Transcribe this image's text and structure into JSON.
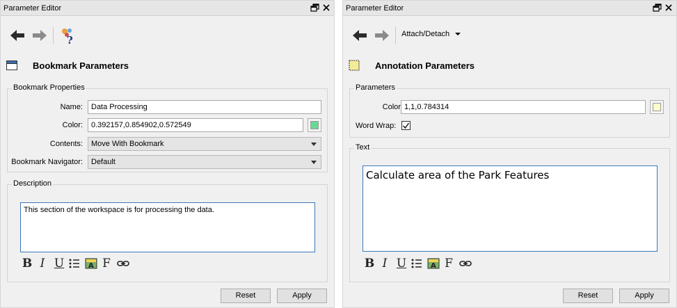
{
  "left": {
    "title": "Parameter Editor",
    "header_title": "Bookmark Parameters",
    "properties_group": "Bookmark Properties",
    "name_label": "Name:",
    "name_value": "Data Processing",
    "color_label": "Color:",
    "color_value": "0.392157,0.854902,0.572549",
    "color_swatch": "#64DA92",
    "contents_label": "Contents:",
    "contents_value": "Move With Bookmark",
    "navigator_label": "Bookmark Navigator:",
    "navigator_value": "Default",
    "description_group": "Description",
    "description_text": "This section of the workspace is for processing the data.",
    "reset": "Reset",
    "apply": "Apply"
  },
  "right": {
    "title": "Parameter Editor",
    "attach_label": "Attach/Detach",
    "header_title": "Annotation Parameters",
    "parameters_group": "Parameters",
    "color_label": "Color:",
    "color_value": "1,1,0.784314",
    "color_swatch": "#FFFFC8",
    "wordwrap_label": "Word Wrap:",
    "wordwrap_checked": true,
    "text_group": "Text",
    "text_value": "Calculate area of the Park Features",
    "reset": "Reset",
    "apply": "Apply"
  },
  "format_icons": [
    "bold-icon",
    "italic-icon",
    "underline-icon",
    "bullet-list-icon",
    "highlight-color-icon",
    "font-icon",
    "link-icon"
  ],
  "colors": {
    "focus_border": "#3A77B6",
    "nav_active": "#2B2B2B",
    "nav_inactive": "#8A8A8A"
  }
}
